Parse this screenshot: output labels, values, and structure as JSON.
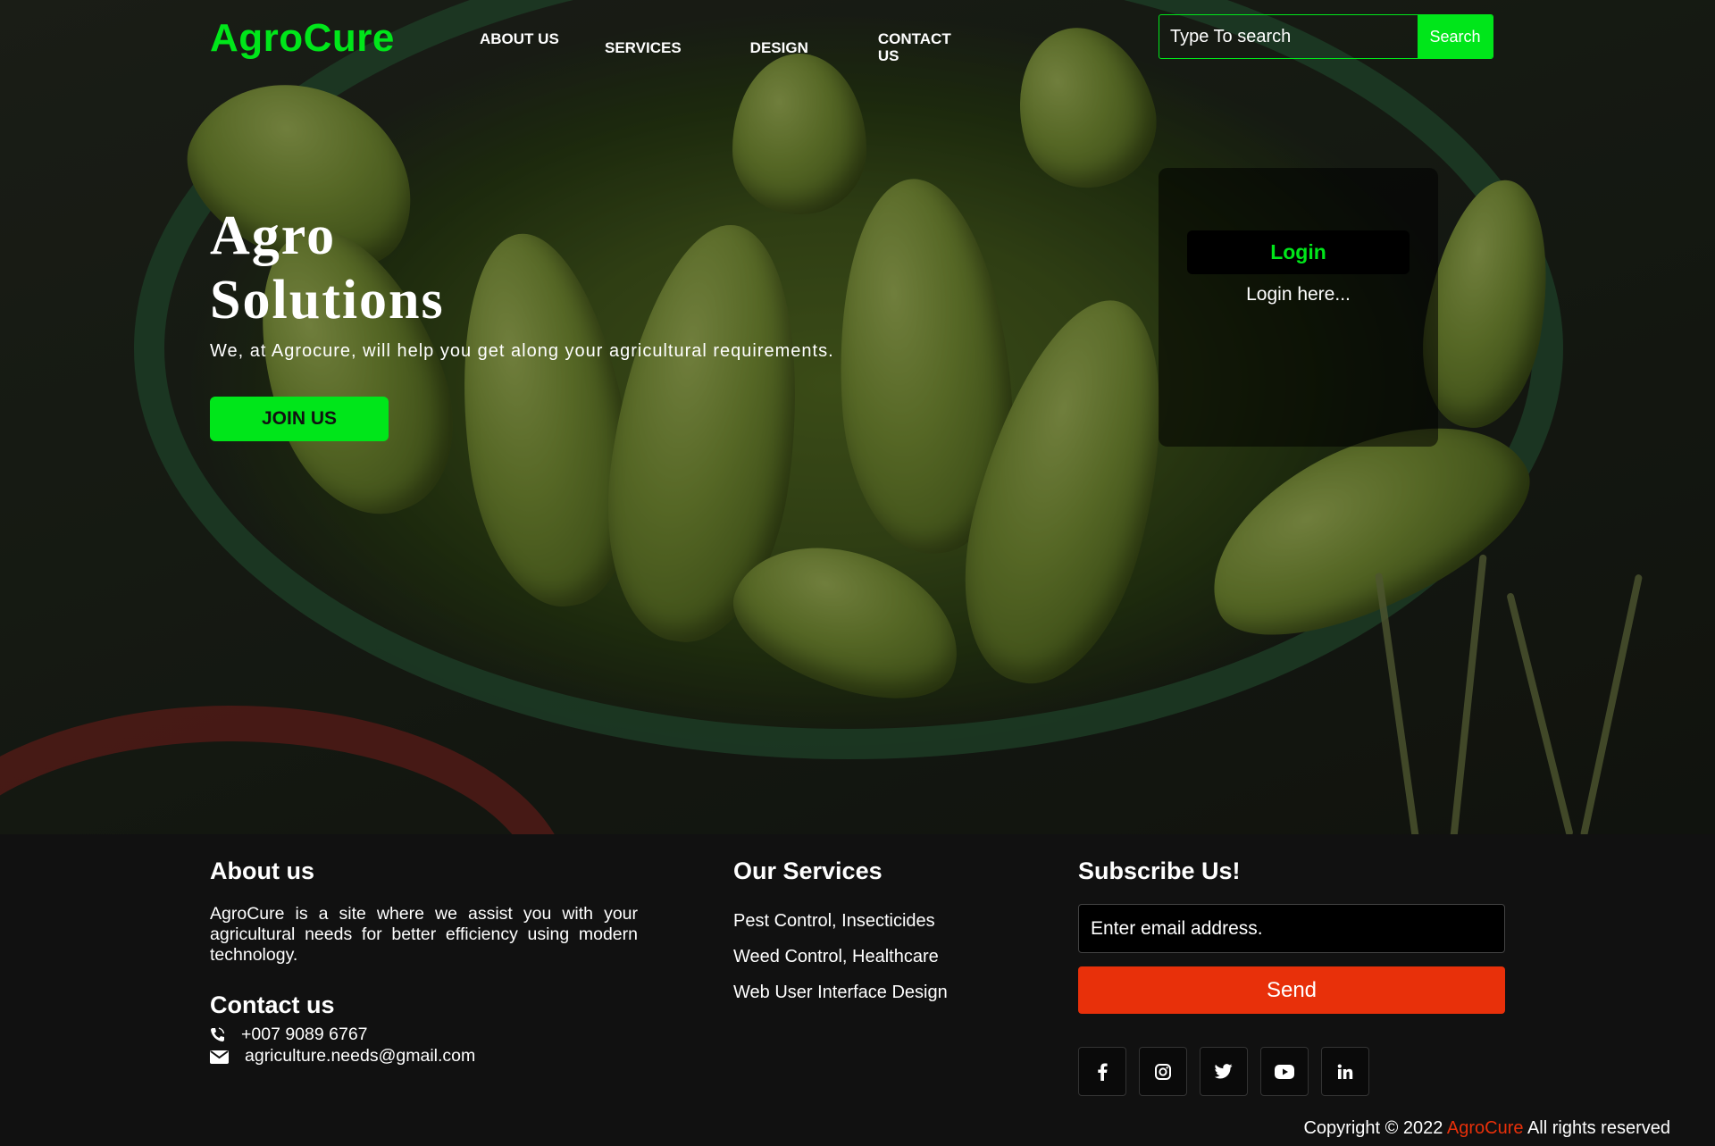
{
  "header": {
    "logo": "AgroCure",
    "nav": [
      {
        "label": "ABOUT US"
      },
      {
        "label": "SERVICES"
      },
      {
        "label": "DESIGN"
      },
      {
        "label": "CONTACT US"
      }
    ],
    "search": {
      "placeholder": "Type To search",
      "button_label": "Search"
    }
  },
  "hero": {
    "title": "Agro Solutions",
    "subtitle": "We, at Agrocure, will help you get along your agricultural requirements.",
    "join_label": "JOIN US"
  },
  "login_card": {
    "title": "Login",
    "text": "Login here..."
  },
  "footer": {
    "about": {
      "heading": "About us",
      "text": "AgroCure is a site where we assist you with your agricultural needs for better efficiency using modern technology."
    },
    "contact": {
      "heading": "Contact us",
      "phone": "+007 9089 6767",
      "email": "agriculture.needs@gmail.com"
    },
    "services": {
      "heading": "Our Services",
      "items": [
        "Pest Control, Insecticides",
        "Weed Control, Healthcare",
        "Web User Interface Design"
      ]
    },
    "subscribe": {
      "heading": "Subscribe Us!",
      "email_placeholder": "Enter email address.",
      "send_label": "Send"
    },
    "social_icons": [
      "facebook-icon",
      "instagram-icon",
      "twitter-icon",
      "youtube-icon",
      "linkedin-icon"
    ],
    "copyright": {
      "prefix": "Copyright © 2022 ",
      "brand": "AgroCure",
      "suffix": " All rights reserved"
    }
  },
  "colors": {
    "accent": "#00e61a",
    "brand_red": "#e8300a",
    "footer_bg": "#111111"
  }
}
